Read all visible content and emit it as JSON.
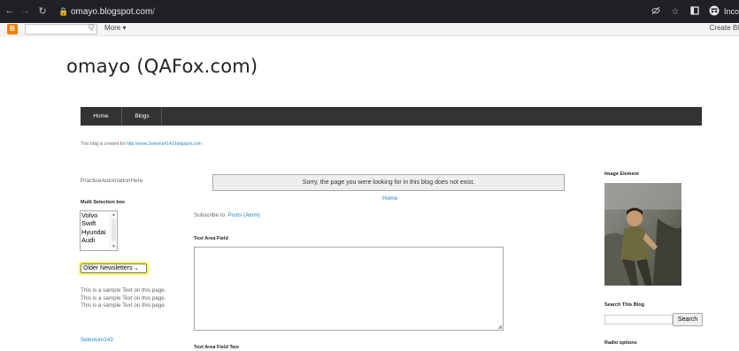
{
  "browser": {
    "url_host": "omayo.blogspot.com",
    "url_rest": "/",
    "incognito_label": "Inco",
    "icons": [
      "back-icon",
      "forward-icon",
      "reload-icon",
      "lock-icon",
      "eye-off-icon",
      "star-icon",
      "tab-icon",
      "incognito-icon"
    ]
  },
  "blogger_bar": {
    "more_label": "More ▾",
    "create_label": "Create Bl"
  },
  "blog": {
    "title": "omayo (QAFox.com)",
    "nav": [
      "Home",
      "Blogs"
    ],
    "description_prefix": "This blog is created for ",
    "description_link": "http://www.Selenium143.blogspot.com"
  },
  "left": {
    "practice_text": "PracticeAutomationHere",
    "multi_select_title": "Multi Selection box",
    "multi_select_options": [
      "Volvo",
      "Swift",
      "Hyundai",
      "Audi"
    ],
    "older_newsletters": "Older Newsletters",
    "sample_text": "This is a sample Text on this page. This is a sample Text on this page. This is a sample Text on this page.",
    "selenium_link": "Selenium143"
  },
  "main": {
    "error_message": "Sorry, the page you were looking for in this blog does not exist.",
    "pager_home": "Home",
    "subscribe_prefix": "Subscribe to: ",
    "subscribe_link": "Posts (Atom)",
    "text_area_title": "Text Area Field",
    "text_area_two_title": "Text Area Field Two"
  },
  "right": {
    "image_title": "Image Element",
    "search_title": "Search This Blog",
    "search_button": "Search",
    "radio_title": "Radio options"
  }
}
